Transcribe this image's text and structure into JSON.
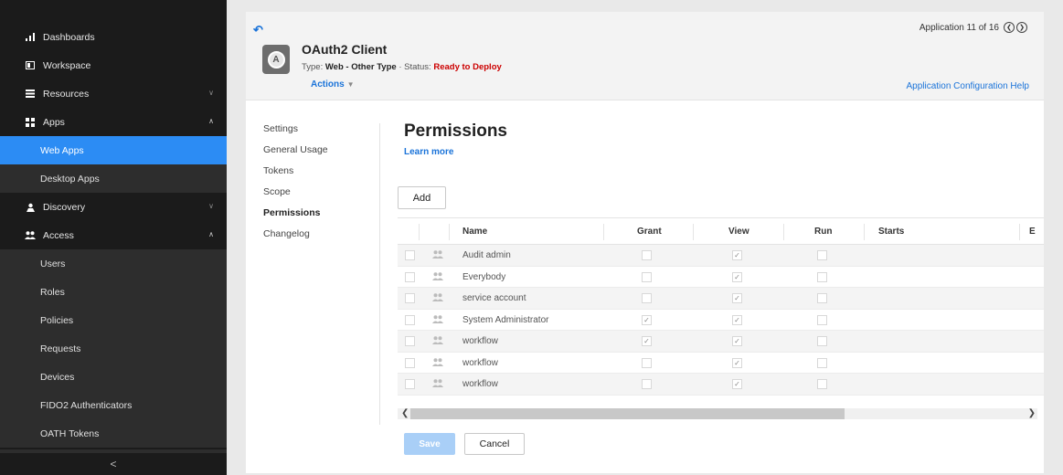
{
  "sidebar": {
    "items": [
      {
        "label": "Dashboards",
        "icon": "bar-chart-icon"
      },
      {
        "label": "Workspace",
        "icon": "workspace-icon"
      },
      {
        "label": "Resources",
        "icon": "list-icon"
      },
      {
        "label": "Apps",
        "icon": "apps-grid-icon"
      },
      {
        "label": "Web Apps"
      },
      {
        "label": "Desktop Apps"
      },
      {
        "label": "Discovery",
        "icon": "discovery-icon"
      },
      {
        "label": "Access",
        "icon": "users-icon"
      },
      {
        "label": "Users"
      },
      {
        "label": "Roles"
      },
      {
        "label": "Policies"
      },
      {
        "label": "Requests"
      },
      {
        "label": "Devices"
      },
      {
        "label": "FIDO2 Authenticators"
      },
      {
        "label": "OATH Tokens"
      }
    ],
    "collapse_glyph": "<"
  },
  "header": {
    "title": "OAuth2 Client",
    "type_label": "Type:",
    "type_value": "Web - Other Type",
    "separator": "·",
    "status_label": "Status:",
    "status_value": "Ready to Deploy",
    "actions_label": "Actions",
    "pager_text": "Application 11 of 16",
    "help_link": "Application Configuration Help",
    "logo_letter": "A"
  },
  "subnav": [
    "Settings",
    "General Usage",
    "Tokens",
    "Scope",
    "Permissions",
    "Changelog"
  ],
  "permissions": {
    "title": "Permissions",
    "learn_more": "Learn more",
    "add_label": "Add",
    "columns": [
      "Name",
      "Grant",
      "View",
      "Run",
      "Starts",
      "E"
    ],
    "rows": [
      {
        "name": "Audit admin",
        "grant": false,
        "view": true,
        "run": false
      },
      {
        "name": "Everybody",
        "grant": false,
        "view": true,
        "run": false
      },
      {
        "name": "service account",
        "grant": false,
        "view": true,
        "run": false
      },
      {
        "name": "System Administrator",
        "grant": true,
        "view": true,
        "run": false
      },
      {
        "name": "workflow",
        "grant": true,
        "view": true,
        "run": false
      },
      {
        "name": "workflow",
        "grant": false,
        "view": true,
        "run": false
      },
      {
        "name": "workflow",
        "grant": false,
        "view": true,
        "run": false
      }
    ]
  },
  "footer": {
    "save_label": "Save",
    "cancel_label": "Cancel"
  },
  "colors": {
    "accent": "#2c8cf4",
    "link": "#1a73d9",
    "status": "#cc0000",
    "sidebar_bg": "#1b1b1b"
  }
}
